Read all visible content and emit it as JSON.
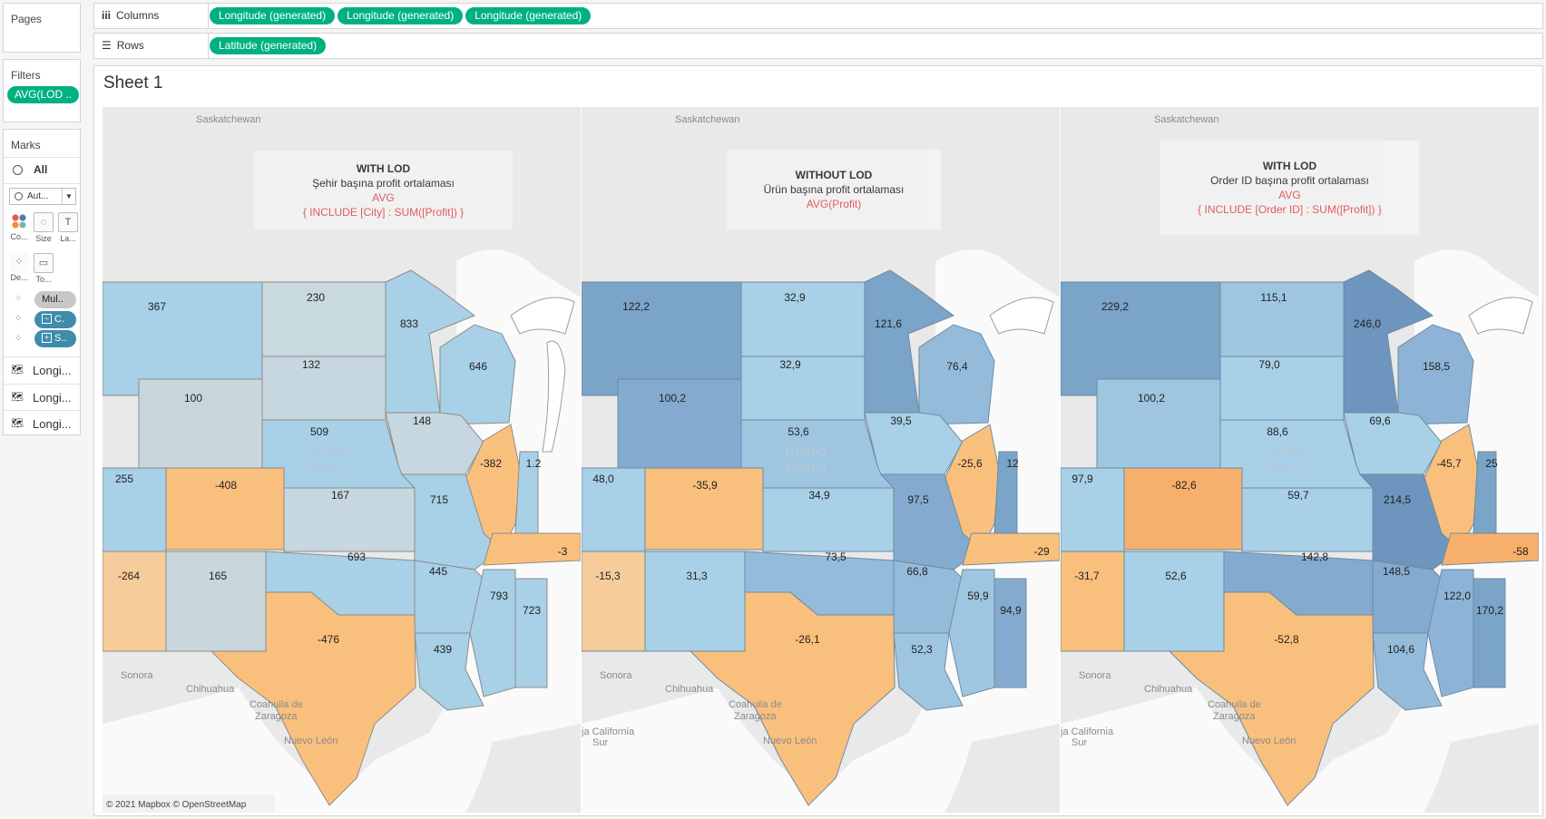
{
  "sidebar": {
    "pages_title": "Pages",
    "filters_title": "Filters",
    "filter_pill": "AVG(LOD ..",
    "marks_title": "Marks",
    "marks_all": "All",
    "marks_type": "Aut...",
    "mark_buttons": [
      "Co...",
      "Size",
      "La...",
      "De...",
      "To..."
    ],
    "mark_pills": [
      "Mul..",
      "C.",
      "S.."
    ],
    "geo_rows": [
      "Longi...",
      "Longi...",
      "Longi..."
    ]
  },
  "shelves": {
    "columns_label": "Columns",
    "columns_pills": [
      "Longitude (generated)",
      "Longitude (generated)",
      "Longitude (generated)"
    ],
    "rows_label": "Rows",
    "rows_pills": [
      "Latitude (generated)"
    ]
  },
  "sheet": {
    "title": "Sheet 1",
    "attribution": "© 2021 Mapbox © OpenStreetMap"
  },
  "colors": {
    "accent_green": "#00b180",
    "pill_blue": "#3e8cab",
    "highlight_red": "#e15759"
  },
  "maps": [
    {
      "note_title": "WITH LOD",
      "note_subtitle": "Şehir başına profit ortalaması",
      "note_agg": "AVG",
      "note_formula": "{ INCLUDE [City] : SUM([Profit]) }",
      "states": {
        "mt": "367",
        "nd": "230",
        "sd": "132",
        "mn": "833",
        "wi": "646",
        "wy": "100",
        "ne": "509",
        "ia": "148",
        "il": "-382",
        "co": "-408",
        "ks": "167",
        "mo": "715",
        "nv": "255",
        "az": "-264",
        "nm": "165",
        "ok": "693",
        "tx": "-476",
        "ar": "445",
        "la": "439",
        "ms": "793",
        "al": "723",
        "in": "1.2",
        "tn": "-3"
      }
    },
    {
      "note_title": "WITHOUT LOD",
      "note_subtitle": "Ürün başına profit ortalaması",
      "note_agg": "AVG(Profit)",
      "note_formula": "",
      "states": {
        "mt": "122,2",
        "nd": "32,9",
        "sd": "32,9",
        "mn": "121,6",
        "wi": "76,4",
        "wy": "100,2",
        "ne": "53,6",
        "ia": "39,5",
        "il": "-25,6",
        "co": "-35,9",
        "ks": "34,9",
        "mo": "97,5",
        "nv": "48,0",
        "az": "-15,3",
        "nm": "31,3",
        "ok": "73,5",
        "tx": "-26,1",
        "ar": "66,8",
        "la": "52,3",
        "ms": "59,9",
        "al": "94,9",
        "in": "12",
        "tn": "-29"
      }
    },
    {
      "note_title": "WITH LOD",
      "note_subtitle": "Order ID başına profit ortalaması",
      "note_agg": "AVG",
      "note_formula": "{ INCLUDE [Order ID] : SUM([Profit]) }",
      "states": {
        "mt": "229,2",
        "nd": "115,1",
        "sd": "79,0",
        "mn": "246,0",
        "wi": "158,5",
        "wy": "100,2",
        "ne": "88,6",
        "ia": "69,6",
        "il": "-45,7",
        "co": "-82,6",
        "ks": "59,7",
        "mo": "214,5",
        "nv": "97,9",
        "az": "-31,7",
        "nm": "52,6",
        "ok": "142,8",
        "tx": "-52,8",
        "ar": "148,5",
        "la": "104,6",
        "ms": "122,0",
        "al": "170,2",
        "in": "25",
        "tn": "-58"
      }
    }
  ],
  "map_labels": {
    "saskatchewan": "Saskatchewan",
    "united": "United",
    "states": "States",
    "sonora": "Sonora",
    "chihuahua": "Chihuahua",
    "coahuila1": "Coahuila de",
    "coahuila2": "Zaragoza",
    "nuevo_leon": "Nuevo León",
    "baja": "ja California",
    "sur": "Sur"
  }
}
